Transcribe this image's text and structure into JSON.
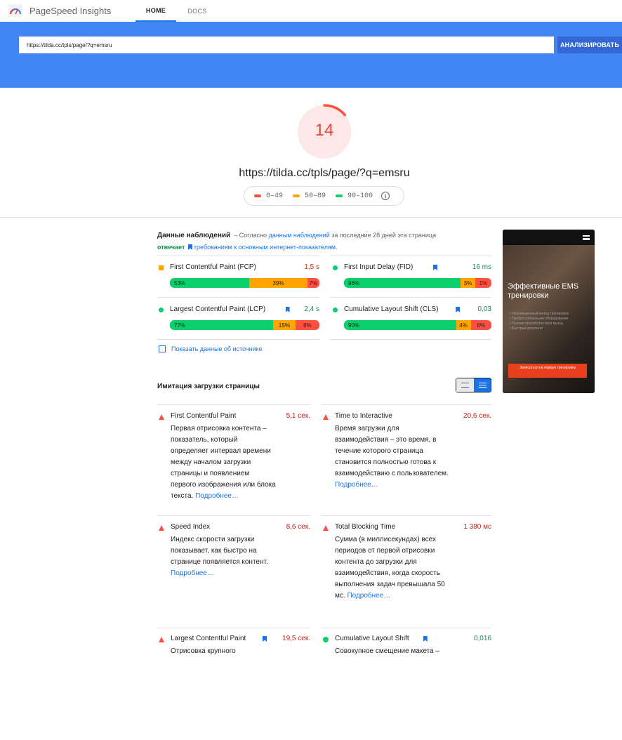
{
  "header": {
    "app_title": "PageSpeed Insights",
    "tabs": [
      "HOME",
      "DOCS"
    ]
  },
  "search": {
    "url_value": "https://tilda.cc/tpls/page/?q=emsru",
    "analyze_label": "АНАЛИЗИРОВАТЬ"
  },
  "score": {
    "value": "14",
    "fraction": 0.14,
    "color": "#ff4e42",
    "tested_url": "https://tilda.cc/tpls/page/?q=emsru"
  },
  "legend": {
    "ranges": [
      {
        "label": "0–49",
        "color": "#ff4e42"
      },
      {
        "label": "50–89",
        "color": "#ffa400"
      },
      {
        "label": "90–100",
        "color": "#0cce6b"
      }
    ]
  },
  "field": {
    "title": "Данные наблюдений",
    "dash": "–",
    "text1": "Согласно",
    "link1": "данным наблюдений",
    "text2": "за последние 28 дней эта страница",
    "status": "отвечает",
    "link2": "требованиям к основным интернет-показателям",
    "period": ".",
    "metrics": [
      {
        "name": "First Contentful Paint (FCP)",
        "value": "1,5 s",
        "value_color": "#c33300",
        "marker": "square",
        "marker_color": "#ffa400",
        "core": false,
        "dist": [
          "53%",
          "39%",
          "7%"
        ],
        "fractions": [
          0.53,
          0.39,
          0.08
        ]
      },
      {
        "name": "First Input Delay (FID)",
        "value": "16 ms",
        "value_color": "#0d904f",
        "marker": "circle",
        "marker_color": "#0cce6b",
        "core": true,
        "dist": [
          "96%",
          "3%",
          "1%"
        ],
        "fractions": [
          0.79,
          0.1,
          0.11
        ]
      },
      {
        "name": "Largest Contentful Paint (LCP)",
        "value": "2,4 s",
        "value_color": "#0d904f",
        "marker": "circle",
        "marker_color": "#0cce6b",
        "core": true,
        "dist": [
          "77%",
          "15%",
          "8%"
        ],
        "fractions": [
          0.69,
          0.15,
          0.16
        ]
      },
      {
        "name": "Cumulative Layout Shift (CLS)",
        "value": "0,03",
        "value_color": "#0d904f",
        "marker": "circle",
        "marker_color": "#0cce6b",
        "core": true,
        "dist": [
          "90%",
          "4%",
          "6%"
        ],
        "fractions": [
          0.76,
          0.1,
          0.14
        ]
      }
    ],
    "source_link": "Показать данные об источнике"
  },
  "preview": {
    "title": "Эффективные EMS тренировки",
    "bullets": [
      "Инновационный метод тренировок",
      "Профессиональное оборудование",
      "Полная проработка всех мышц",
      "Быстрый результат"
    ],
    "cta": "Записаться на первую тренировку"
  },
  "lab": {
    "title": "Имитация загрузки страницы",
    "more": "Подробнее…",
    "metrics": [
      {
        "name": "First Contentful Paint",
        "value": "5,1 сек.",
        "status": "poor",
        "core": false,
        "desc": "Первая отрисовка контента – показатель, который определяет интервал времени между началом загрузки страницы и появлением первого изображения или блока текста."
      },
      {
        "name": "Time to Interactive",
        "value": "20,6 сек.",
        "status": "poor",
        "core": false,
        "desc": "Время загрузки для взаимодействия – это время, в течение которого страница становится полностью готова к взаимодействию с пользователем."
      },
      {
        "name": "Speed Index",
        "value": "8,6 сек.",
        "status": "poor",
        "core": false,
        "desc": "Индекс скорости загрузки показывает, как быстро на странице появляется контент."
      },
      {
        "name": "Total Blocking Time",
        "value": "1 380 мс",
        "status": "poor",
        "core": false,
        "desc": "Сумма (в миллисекундах) всех периодов от первой отрисовки контента до загрузки для взаимодействия, когда скорость выполнения задач превышала 50 мс."
      },
      {
        "name": "Largest Contentful Paint",
        "value": "19,5 сек.",
        "status": "poor",
        "core": true,
        "desc": "Отрисовка крупного"
      },
      {
        "name": "Cumulative Layout Shift",
        "value": "0,016",
        "status": "good",
        "core": true,
        "desc": "Совокупное смещение макета –"
      }
    ]
  }
}
